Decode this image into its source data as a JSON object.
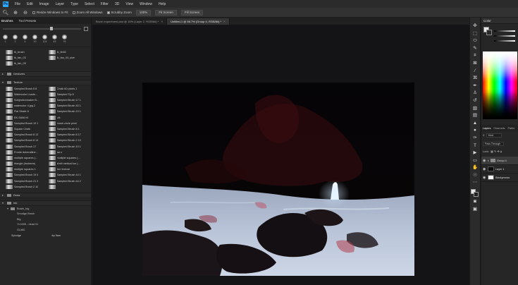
{
  "menubar": {
    "logo": "Ps",
    "items": [
      "File",
      "Edit",
      "Image",
      "Layer",
      "Type",
      "Select",
      "Filter",
      "3D",
      "View",
      "Window",
      "Help"
    ]
  },
  "options": {
    "resize_windows": "Resize Windows to Fit",
    "zoom_all": "Zoom All Windows",
    "scrubby_zoom": "Scrubby Zoom",
    "zoom_100": "100%",
    "fit_screen": "Fit Screen",
    "fill_screen": "Fill Screen"
  },
  "brush_panel": {
    "tabs": [
      "Brushes",
      "Tool Presets"
    ],
    "preset_sizes": [
      "1",
      "2",
      "4",
      "10",
      "124",
      "43",
      "76"
    ],
    "top_items": [
      "tk_brush",
      "tk_fin02",
      "tk_fan_03",
      "tk_fan_04_size",
      "tk_fan_05",
      ""
    ],
    "groups": {
      "gestures": "Gestures",
      "texture": "Texture",
      "draw": "Draw",
      "ink": "Ink",
      "bowls": "Bowls_big"
    },
    "texture_brushes": [
      "Sampled Brush 5 8",
      "Chalk 60 pixels 1",
      "Watercolor Loade...",
      "Sampled Tip 6",
      "Sobjectionmaker B...",
      "Sampled Brush 17 1",
      "watercolor 4 jpg 2",
      "Sampled Brush 40 1",
      "Flat Strafe 8",
      "Sampled Brush 19 1",
      "EK-S#06 h5",
      "o/k",
      "Sampled Brush 19 1",
      "brush circle pixel",
      "Square Chalk",
      "Sampled Brush 8 1",
      "Sampled Brush 8 13",
      "Sampled Brush 8 17",
      "Sampled Brush 8 14",
      "Sampled Brush 2 10",
      "Sampled Brush 17",
      "Sampled Brush 10 1",
      "Fronte duberalline...",
      "aa u",
      "multiple squares (...",
      "multiple squares (...",
      "triangle (brokenw)",
      "shelt metical bur (...",
      "multiple squares 1",
      "line texture",
      "Sampled Brush 19 5",
      "Sampled Brush 44 1",
      "Sampled Brush 21 3",
      "Sampled Brush 44 2",
      "Sampled Brush 2 10",
      ""
    ],
    "bowls_items": [
      "Smudge Brush",
      "Big",
      "YL0405 - dead 01",
      "GL#60",
      "Splodge",
      "dry flam"
    ]
  },
  "doc_tabs": [
    {
      "label": "Brush experiment.psd @ 16% (Layer 2, RGB/8#) *",
      "active": false
    },
    {
      "label": "Untitled-1 @ 66.7% (Group 4, RGB/8#) *",
      "active": true
    }
  ],
  "color_panel": {
    "title": "Color"
  },
  "layers_panel": {
    "tabs": [
      "Layers",
      "Channels",
      "Paths"
    ],
    "filter_kind": "Kind",
    "blend_mode": "Pass Through",
    "lock_label": "Lock:",
    "layers": [
      {
        "name": "Group 4",
        "selected": true
      },
      {
        "name": "Layer 1",
        "selected": false
      },
      {
        "name": "Background",
        "selected": false
      }
    ]
  }
}
